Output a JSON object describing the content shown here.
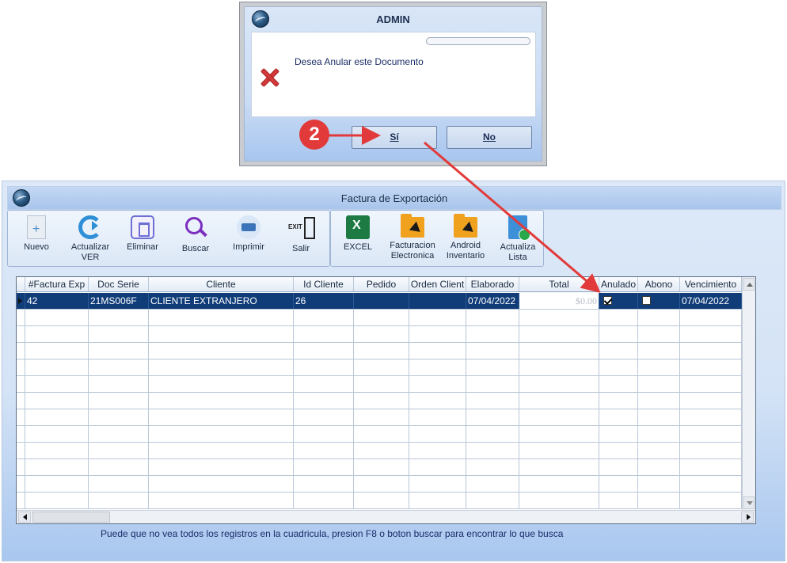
{
  "main_window": {
    "title": "Factura de Exportación"
  },
  "toolbar": {
    "new_label": "Nuevo",
    "refresh_label_1": "Actualizar",
    "refresh_label_2": "VER",
    "delete_label": "Eliminar",
    "search_label": "Buscar",
    "print_label": "Imprimir",
    "exit_label": "Salir",
    "excel_label": "EXCEL",
    "efact_label_1": "Facturacion",
    "efact_label_2": "Electronica",
    "android_label_1": "Android",
    "android_label_2": "Inventario",
    "update_label_1": "Actualiza",
    "update_label_2": "Lista"
  },
  "grid": {
    "columns": [
      "#Factura Exp",
      "Doc Serie",
      "Cliente",
      "Id Cliente",
      "Pedido",
      "Orden Client",
      "Elaborado",
      "Total",
      "Anulado",
      "Abono",
      "Vencimiento"
    ],
    "rows": [
      {
        "factura": "42",
        "doc_serie": "21MS006F",
        "cliente": "CLIENTE EXTRANJERO",
        "id_cliente": "26",
        "pedido": "",
        "orden": "",
        "elaborado": "07/04/2022",
        "total": "$0.00",
        "anulado": true,
        "abono": false,
        "vencimiento": "07/04/2022"
      }
    ]
  },
  "status": {
    "hint": "Puede que no vea todos los registros en la cuadricula, presion F8 o boton buscar para encontrar lo que busca"
  },
  "dialog": {
    "title": "ADMIN",
    "message": "Desea Anular este Documento",
    "yes_label": "Sí",
    "no_label": "No"
  },
  "annotation": {
    "step": "2",
    "color": "#e23a3a"
  },
  "colors": {
    "selected_row": "#103c78",
    "window_gradient_bottom": "#a9c7ef"
  }
}
